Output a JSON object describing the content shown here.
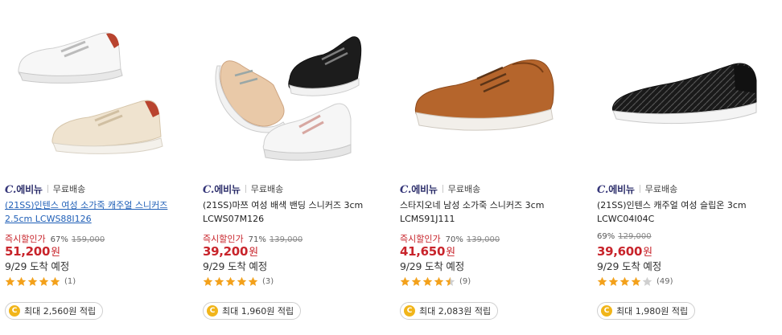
{
  "products": [
    {
      "brand_prefix": "C.",
      "brand_name": "에비뉴",
      "shipping": "무료배송",
      "title": "(21SS)인텐스 여성 소가죽 캐주얼 스니커즈 2.5cm LCWS88I126",
      "instant_label": "즉시할인가",
      "discount": "67%",
      "original_price": "159,000",
      "price": "51,200",
      "currency": "원",
      "arrival": "9/29 도착 예정",
      "rating": 5,
      "review_count": "(1)",
      "reward_text": "최대 2,560원 적립",
      "image_icon": "white-beige-sneakers-image"
    },
    {
      "brand_prefix": "C.",
      "brand_name": "에비뉴",
      "shipping": "무료배송",
      "title": "(21SS)마쯔 여성 배색 밴딩 스니커즈 3cm LCWS07M126",
      "instant_label": "즉시할인가",
      "discount": "71%",
      "original_price": "139,000",
      "price": "39,200",
      "currency": "원",
      "arrival": "9/29 도착 예정",
      "rating": 5,
      "review_count": "(3)",
      "reward_text": "최대 1,960원 적립",
      "image_icon": "three-color-sneakers-image"
    },
    {
      "brand_prefix": "C.",
      "brand_name": "에비뉴",
      "shipping": "무료배송",
      "title": "스타지오네 남성 소가죽 스니커즈 3cm LCMS91J111",
      "instant_label": "즉시할인가",
      "discount": "70%",
      "original_price": "139,000",
      "price": "41,650",
      "currency": "원",
      "arrival": "9/29 도착 예정",
      "rating": 4.5,
      "review_count": "(9)",
      "reward_text": "최대 2,083원 적립",
      "image_icon": "brown-leather-sneaker-image"
    },
    {
      "brand_prefix": "C.",
      "brand_name": "에비뉴",
      "shipping": "무료배송",
      "title": "(21SS)인텐스 캐주얼 여성 슬립온 3cm LCWC04I04C",
      "instant_label": "",
      "discount": "69%",
      "original_price": "129,000",
      "price": "39,600",
      "currency": "원",
      "arrival": "9/29 도착 예정",
      "rating": 4,
      "review_count": "(49)",
      "reward_text": "최대 1,980원 적립",
      "image_icon": "black-woven-slipon-image"
    }
  ],
  "colors": {
    "sale_red": "#c8242b",
    "brand_navy": "#2d2f6b",
    "star_orange": "#f3a11b",
    "coin_yellow": "#f1b51a"
  }
}
